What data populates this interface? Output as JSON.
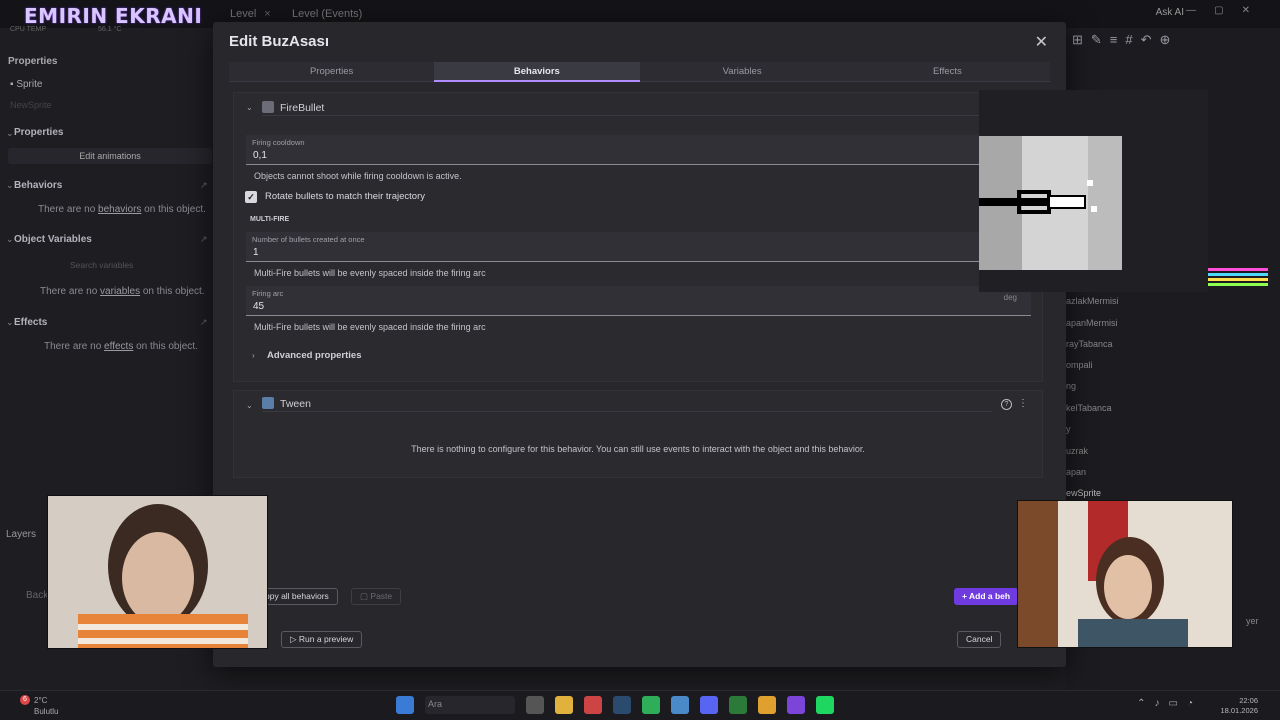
{
  "overlay": {
    "logo_text": "EMIRIN EKRANI",
    "cpu_label": "CPU TEMP",
    "cpu_value": "56.1 °C"
  },
  "background": {
    "tabs": [
      "Level",
      "Level (Events)"
    ],
    "ask_ai": "Ask AI",
    "left_panel": {
      "title": "Properties",
      "object_type": "Sprite",
      "object_name_placeholder": "NewSprite",
      "properties_label": "Properties",
      "edit_animations": "Edit animations",
      "behaviors_label": "Behaviors",
      "behaviors_empty_pre": "There are no ",
      "behaviors_empty_link": "behaviors",
      "behaviors_empty_post": " on this object.",
      "variables_label": "Object Variables",
      "variables_search_placeholder": "Search variables",
      "variables_empty_pre": "There are no ",
      "variables_empty_link": "variables",
      "variables_empty_post": " on this object.",
      "effects_label": "Effects",
      "effects_empty_pre": "There are no ",
      "effects_empty_link": "effects",
      "effects_empty_post": " on this object.",
      "layers_label": "Layers",
      "back_label": "Back"
    },
    "right_panel": {
      "items": [
        "azlakMermisi",
        "apanMermisi",
        "rayTabanca",
        "ompali",
        "ng",
        "kelTabanca",
        "y",
        "uzrak",
        "apan",
        "ewSprite"
      ],
      "layer_btn": "yer"
    }
  },
  "modal": {
    "title": "Edit BuzAsası",
    "tabs": [
      {
        "label": "Properties",
        "active": false
      },
      {
        "label": "Behaviors",
        "active": true
      },
      {
        "label": "Variables",
        "active": false
      },
      {
        "label": "Effects",
        "active": false
      }
    ],
    "firebullet": {
      "name": "FireBullet",
      "cooldown_label": "Firing cooldown",
      "cooldown_value": "0,1",
      "cooldown_help": "Objects cannot shoot while firing cooldown is active.",
      "rotate_label": "Rotate bullets to match their trajectory",
      "rotate_checked": true,
      "multifire_heading": "MULTI-FIRE",
      "bullets_label": "Number of bullets created at once",
      "bullets_value": "1",
      "bullets_help": "Multi-Fire bullets will be evenly spaced inside the firing arc",
      "arc_label": "Firing arc",
      "arc_value": "45",
      "arc_unit": "deg",
      "arc_help": "Multi-Fire bullets will be evenly spaced inside the firing arc",
      "advanced_label": "Advanced properties"
    },
    "tween": {
      "name": "Tween",
      "message": "There is nothing to configure for this behavior. You can still use events to interact with the object and this behavior."
    },
    "footer": {
      "copy_all": "opy all behaviors",
      "paste": "Paste",
      "run_preview": "Run a preview",
      "add_behavior": "Add a beh",
      "cancel": "Cancel"
    }
  },
  "taskbar": {
    "weather_temp": "2°C",
    "weather_desc": "Bulutlu",
    "weather_badge": "6",
    "search_placeholder": "Ara",
    "time": "22:06",
    "date": "18.01.2026"
  },
  "colors": {
    "accent": "#6f3ae0",
    "tab_underline": "#b18cff",
    "modal_bg": "#27272c"
  }
}
